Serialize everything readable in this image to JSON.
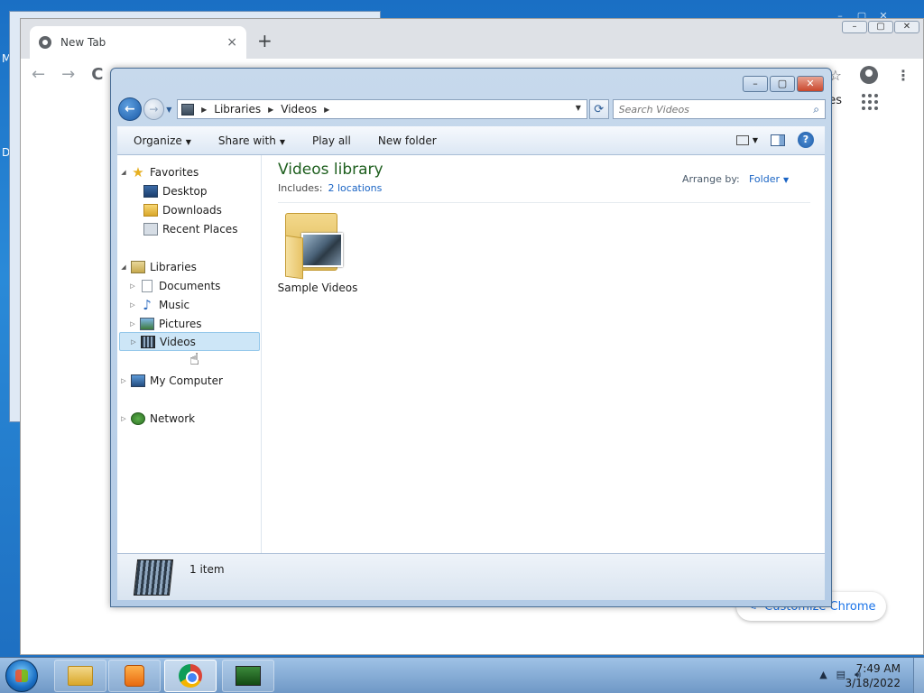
{
  "desktop": {
    "letters": [
      "M",
      "D"
    ]
  },
  "chrome": {
    "tab_title": "New Tab",
    "tab_close": "×",
    "new_tab": "+",
    "back": "←",
    "forward": "→",
    "reload": "C",
    "images_link": "ages",
    "customize_label": "Customize Chrome",
    "star": "☆",
    "kebab": "⋮"
  },
  "explorer": {
    "breadcrumbs": [
      "Libraries",
      "Videos"
    ],
    "search_placeholder": "Search Videos",
    "commands": {
      "organize": "Organize",
      "share_with": "Share with",
      "play_all": "Play all",
      "new_folder": "New folder"
    },
    "nav": {
      "favorites": "Favorites",
      "desktop": "Desktop",
      "downloads": "Downloads",
      "recent_places": "Recent Places",
      "libraries": "Libraries",
      "documents": "Documents",
      "music": "Music",
      "pictures": "Pictures",
      "videos": "Videos",
      "my_computer": "My Computer",
      "network": "Network"
    },
    "library_title": "Videos library",
    "includes_label": "Includes:",
    "includes_link": "2 locations",
    "arrange_label": "Arrange by:",
    "arrange_value": "Folder",
    "items": [
      {
        "label": "Sample Videos"
      }
    ],
    "item_count": "1 item"
  },
  "taskbar": {
    "time": "7:49 AM",
    "date": "3/18/2022"
  },
  "colors": {
    "library_title": "#1e5f1e",
    "link": "#1a64c4",
    "selection": "#cde6f7",
    "chrome_accent": "#1a73e8"
  }
}
